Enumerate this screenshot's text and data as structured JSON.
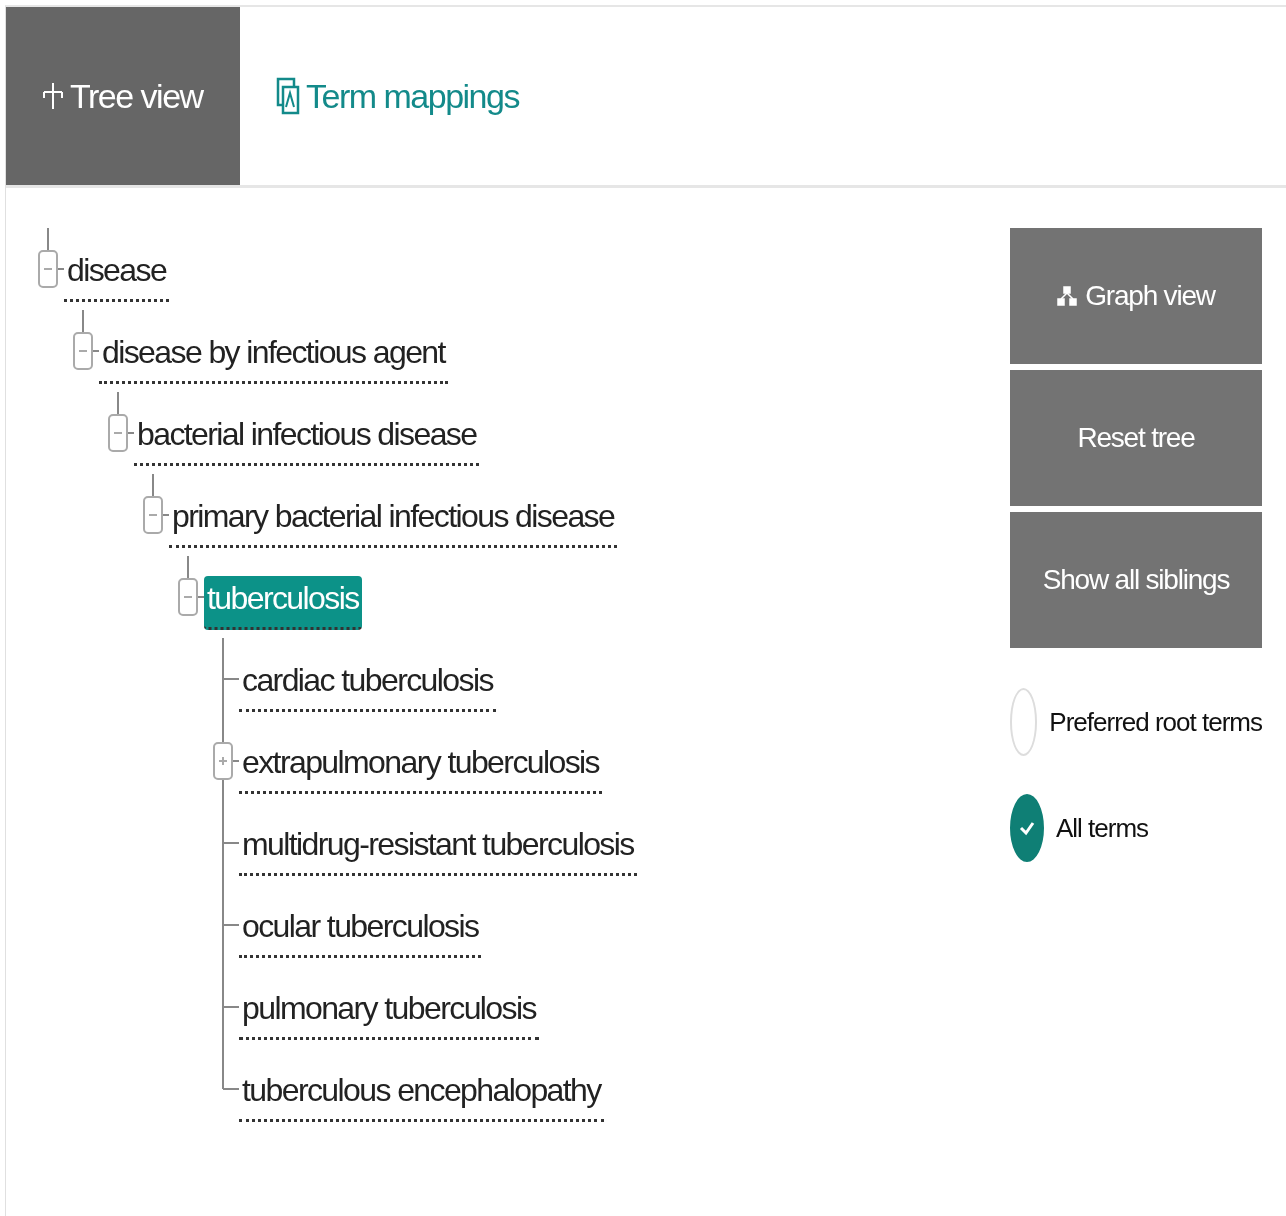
{
  "tabs": [
    {
      "label": "Tree view",
      "selected": true
    },
    {
      "label": "Term mappings",
      "selected": false
    }
  ],
  "tree": [
    {
      "label": "disease",
      "kind": "branch",
      "expanded": true,
      "selected": false,
      "children": [
        {
          "label": "disease by infectious agent",
          "kind": "branch",
          "expanded": true,
          "selected": false,
          "children": [
            {
              "label": "bacterial infectious disease",
              "kind": "branch",
              "expanded": true,
              "selected": false,
              "children": [
                {
                  "label": "primary bacterial infectious disease",
                  "kind": "branch",
                  "expanded": true,
                  "selected": false,
                  "children": [
                    {
                      "label": "tuberculosis",
                      "kind": "branch",
                      "expanded": true,
                      "selected": true,
                      "children": [
                        {
                          "label": "cardiac tuberculosis",
                          "kind": "leaf",
                          "selected": false
                        },
                        {
                          "label": "extrapulmonary tuberculosis",
                          "kind": "branch",
                          "expanded": false,
                          "selected": false
                        },
                        {
                          "label": "multidrug-resistant tuberculosis",
                          "kind": "leaf",
                          "selected": false
                        },
                        {
                          "label": "ocular tuberculosis",
                          "kind": "leaf",
                          "selected": false
                        },
                        {
                          "label": "pulmonary tuberculosis",
                          "kind": "leaf",
                          "selected": false
                        },
                        {
                          "label": "tuberculous encephalopathy",
                          "kind": "leaf",
                          "selected": false
                        }
                      ]
                    }
                  ]
                }
              ]
            }
          ]
        }
      ]
    }
  ],
  "buttons": [
    {
      "label": "Graph view",
      "kind": "graph"
    },
    {
      "label": "Reset tree",
      "kind": "plain"
    },
    {
      "label": "Show all siblings",
      "kind": "plain"
    }
  ],
  "radios": [
    {
      "label": "Preferred root terms",
      "selected": false
    },
    {
      "label": "All terms",
      "selected": true
    }
  ]
}
